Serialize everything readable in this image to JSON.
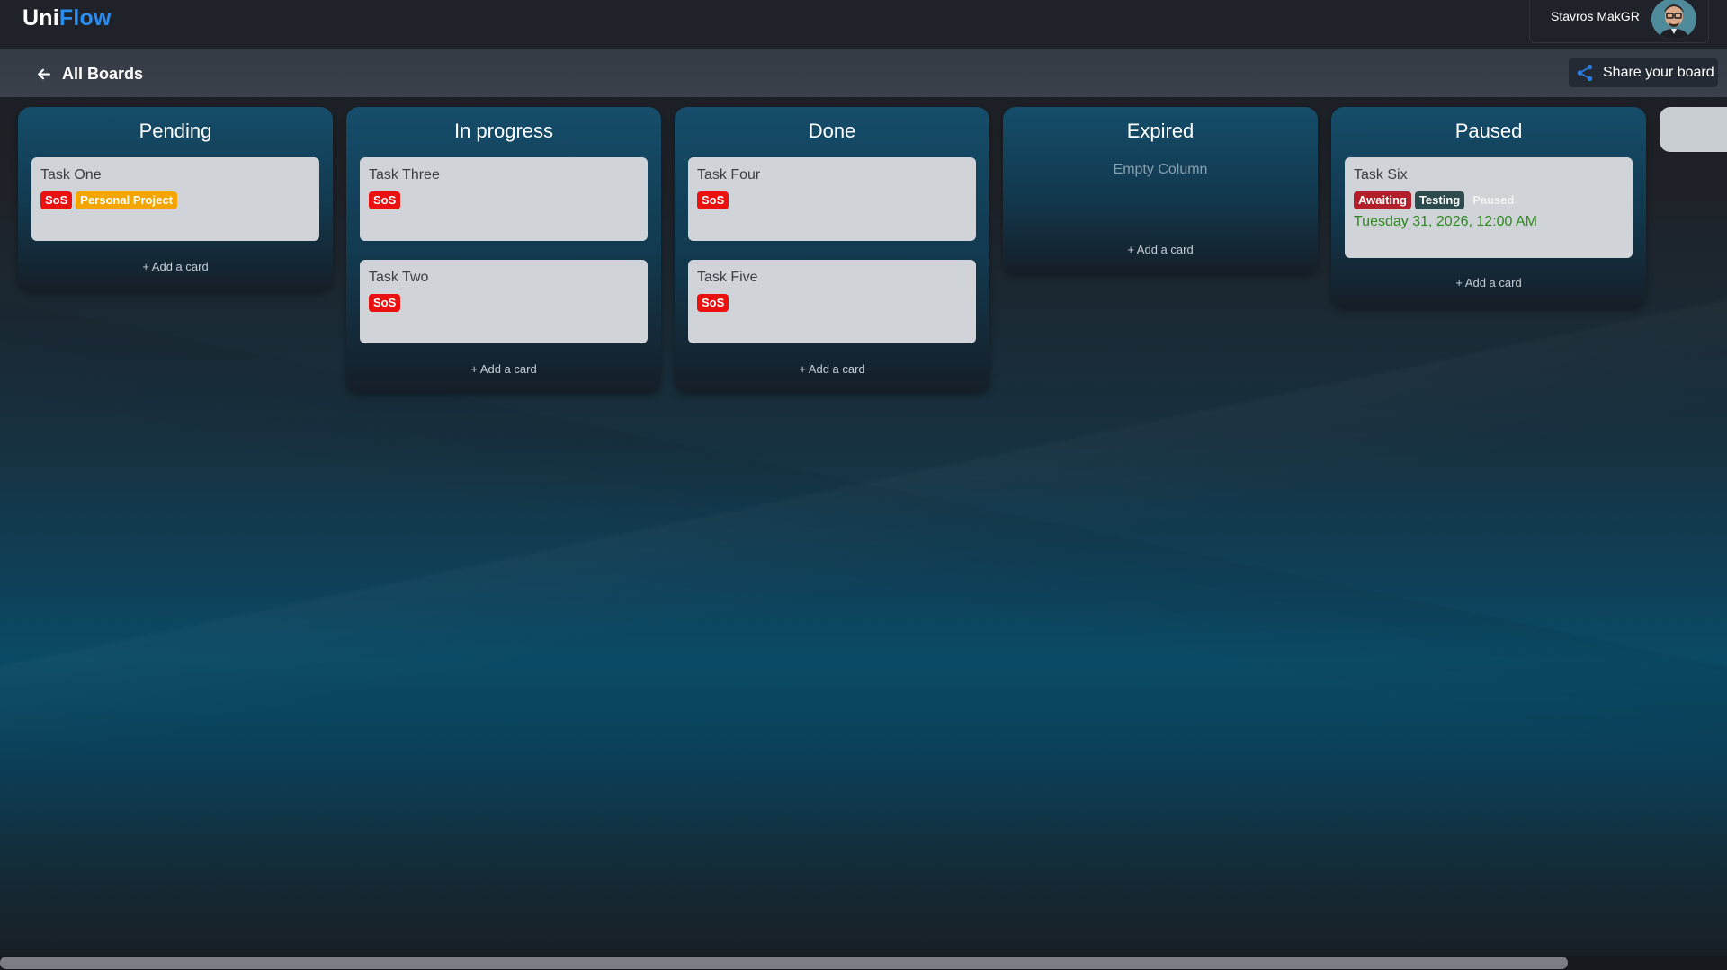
{
  "app": {
    "logo_part1": "Uni",
    "logo_part2": "Flow"
  },
  "user": {
    "name": "Stavros MakGR"
  },
  "board_header": {
    "back_label": "All Boards",
    "share_label": "Share your board"
  },
  "columns": [
    {
      "title": "Pending",
      "add_label": "+ Add a card",
      "cards": [
        {
          "title": "Task One",
          "tags": [
            "SoS",
            "Personal Project"
          ]
        }
      ]
    },
    {
      "title": "In progress",
      "add_label": "+ Add a card",
      "cards": [
        {
          "title": "Task Three",
          "tags": [
            "SoS"
          ]
        },
        {
          "title": "Task Two",
          "tags": [
            "SoS"
          ]
        }
      ]
    },
    {
      "title": "Done",
      "add_label": "+ Add a card",
      "cards": [
        {
          "title": "Task Four",
          "tags": [
            "SoS"
          ]
        },
        {
          "title": "Task Five",
          "tags": [
            "SoS"
          ]
        }
      ]
    },
    {
      "title": "Expired",
      "empty_text": "Empty Column",
      "add_label": "+ Add a card",
      "cards": []
    },
    {
      "title": "Paused",
      "add_label": "+ Add a card",
      "cards": [
        {
          "title": "Task Six",
          "tags": [
            "Awaiting",
            "Testing",
            "Paused"
          ],
          "date": "Tuesday 31, 2026, 12:00 AM"
        }
      ]
    }
  ],
  "colors": {
    "logo_accent": "#2b8cf0",
    "tag_sos": "#ec1111",
    "tag_personal": "#f5a500",
    "tag_awaiting": "#b21f2a",
    "tag_testing": "#2d4a4c",
    "date_text": "#2d8a1e",
    "card_bg": "#d0d4d8"
  }
}
